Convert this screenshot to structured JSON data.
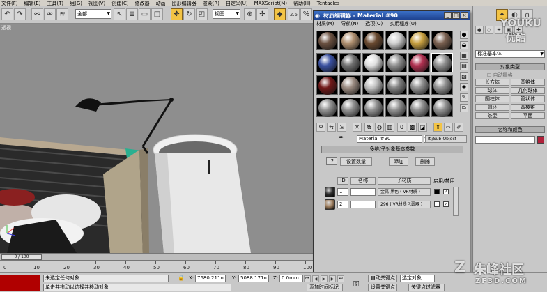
{
  "menubar": [
    "文件(F)",
    "编辑(E)",
    "工具(T)",
    "组(G)",
    "视图(V)",
    "创建(C)",
    "修改器",
    "动画",
    "图形编辑器",
    "渲染(R)",
    "自定义(U)",
    "MAXScript(M)",
    "帮助(H)",
    "Tentacles"
  ],
  "toolbar": {
    "selection_filter": "全部",
    "view_combo": "视图",
    "snap_value": "2.5"
  },
  "viewport": {
    "label": "透视"
  },
  "timeline": {
    "frame_display": "0 / 100",
    "ticks": [
      "0",
      "10",
      "20",
      "30",
      "40",
      "50",
      "60",
      "70",
      "80",
      "90",
      "100"
    ]
  },
  "status": {
    "selection_msg": "未选定任何对象",
    "prompt_msg": "单击并拖动以选择并移动对象",
    "x_label": "X:",
    "x_value": "7680.211n",
    "y_label": "Y:",
    "y_value": "5088.171n",
    "z_label": "Z:",
    "z_value": "0.0mm",
    "add_time_tag": "添加时间标记",
    "auto_key": "自动关键点",
    "set_key": "设置关键点",
    "key_filter": "关键点过滤器",
    "selected_combo": "选定对象"
  },
  "cmdpanel": {
    "category_combo": "标准基本体",
    "object_type_header": "对象类型",
    "autogrid_label": "自动栅格",
    "primitives": [
      "长方体",
      "圆锥体",
      "球体",
      "几何球体",
      "圆柱体",
      "管状体",
      "圆环",
      "四棱锥",
      "茶壶",
      "平面"
    ],
    "name_color_header": "名称和颜色",
    "object_color": "#b0203a"
  },
  "material_editor": {
    "title": "材质编辑器 - Material #90",
    "menu": [
      "材质(M)",
      "导航(N)",
      "选项(O)",
      "实用程序(U)"
    ],
    "slot_colors": [
      [
        "#6a5040",
        "#b09070",
        "#6a4a30",
        "#d0d0d0",
        "#c8a040",
        "#7a6050"
      ],
      [
        "#3a50a0",
        "#707070",
        "#e0e0e0",
        "#909090",
        "#b03050",
        "#909090"
      ],
      [
        "#701818",
        "#9a8a80",
        "#c0c0c0",
        "#808080",
        "#909090",
        "#909090"
      ],
      [
        "#909090",
        "#909090",
        "#909090",
        "#909090",
        "#909090",
        "#909090"
      ]
    ],
    "material_name": "Material #90",
    "material_type": "lti/Sub-Object",
    "rollout_title": "多维/子对象基本参数",
    "sub_count": "2",
    "set_number_btn": "设置数量",
    "add_btn": "添加",
    "delete_btn": "删除",
    "col_id": "ID",
    "col_name": "名称",
    "col_submaterial": "子材质",
    "col_enable": "启用/禁用",
    "rows": [
      {
        "id": "1",
        "name": "",
        "submaterial": "金属-黑色 ( VR材质 )",
        "swatch": "#000000",
        "ball": "#303030"
      },
      {
        "id": "2",
        "name": "",
        "submaterial": "296 ( VR材质包裹器 )",
        "swatch": "#ffffff",
        "ball": "#a08060"
      }
    ]
  },
  "watermarks": {
    "top": "YOUKU",
    "top2": "优酷",
    "bottom": "朱峰社区",
    "bottom_url": "ZF3D.COM"
  }
}
